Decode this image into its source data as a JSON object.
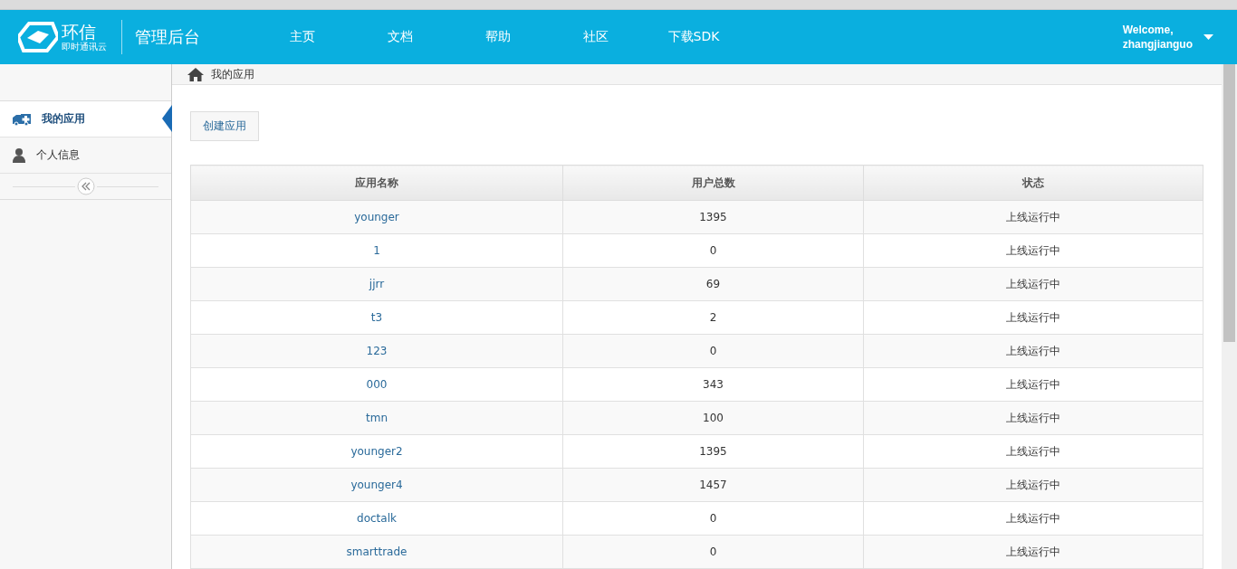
{
  "header": {
    "logo_name": "环信",
    "logo_tagline": "即时通讯云",
    "title": "管理后台",
    "nav": [
      {
        "label": "主页"
      },
      {
        "label": "文档"
      },
      {
        "label": "帮助"
      },
      {
        "label": "社区"
      },
      {
        "label": "下载SDK"
      }
    ],
    "welcome": "Welcome,",
    "username": "zhangjianguo"
  },
  "sidebar": {
    "items": [
      {
        "label": "我的应用",
        "selected": true
      },
      {
        "label": "个人信息",
        "selected": false
      }
    ]
  },
  "breadcrumb": "我的应用",
  "create_button": "创建应用",
  "table": {
    "columns": [
      "应用名称",
      "用户总数",
      "状态"
    ],
    "rows": [
      {
        "name": "younger",
        "users": "1395",
        "status": "上线运行中"
      },
      {
        "name": "1",
        "users": "0",
        "status": "上线运行中"
      },
      {
        "name": "jjrr",
        "users": "69",
        "status": "上线运行中"
      },
      {
        "name": "t3",
        "users": "2",
        "status": "上线运行中"
      },
      {
        "name": "123",
        "users": "0",
        "status": "上线运行中"
      },
      {
        "name": "000",
        "users": "343",
        "status": "上线运行中"
      },
      {
        "name": "tmn",
        "users": "100",
        "status": "上线运行中"
      },
      {
        "name": "younger2",
        "users": "1395",
        "status": "上线运行中"
      },
      {
        "name": "younger4",
        "users": "1457",
        "status": "上线运行中"
      },
      {
        "name": "doctalk",
        "users": "0",
        "status": "上线运行中"
      },
      {
        "name": "smarttrade",
        "users": "0",
        "status": "上线运行中"
      }
    ]
  }
}
